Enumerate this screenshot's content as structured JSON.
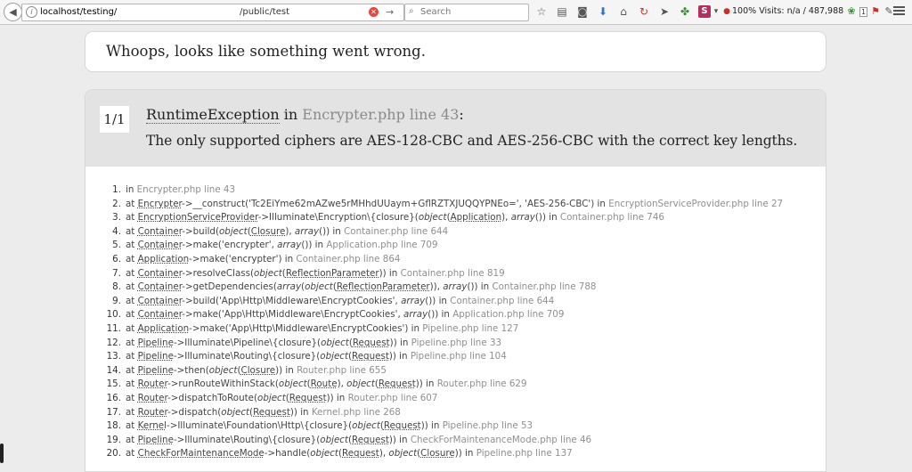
{
  "browser": {
    "url_host": "localhost/testing/",
    "url_path": "/public/test",
    "search_placeholder": "Search",
    "zoom": "100%",
    "visits": "Visits: n/a / 487,988",
    "tail_badge": "1"
  },
  "page": {
    "heading": "Whoops, looks like something went wrong.",
    "count": "1/1",
    "exception_class": "RuntimeException",
    "in_word": " in ",
    "exception_location": "Encrypter.php line 43",
    "colon": ":",
    "message": "The only supported ciphers are AES-128-CBC and AES-256-CBC with the correct key lengths."
  },
  "trace": [
    {
      "n": "1.",
      "parts": [
        [
          "t",
          "in "
        ],
        [
          "m",
          "Encrypter.php line 43"
        ]
      ]
    },
    {
      "n": "2.",
      "parts": [
        [
          "t",
          "at "
        ],
        [
          "u",
          "Encrypter"
        ],
        [
          "t",
          "->__construct('Tc2EiYme62mAZwe5rMHhdUUaym+GflRZTXJUQQYPNEo=', 'AES-256-CBC') in "
        ],
        [
          "m",
          "EncryptionServiceProvider.php line 27"
        ]
      ]
    },
    {
      "n": "3.",
      "parts": [
        [
          "t",
          "at "
        ],
        [
          "u",
          "EncryptionServiceProvider"
        ],
        [
          "t",
          "->Illuminate\\Encryption\\{closure}("
        ],
        [
          "i",
          "object"
        ],
        [
          "t",
          "("
        ],
        [
          "u",
          "Application"
        ],
        [
          "t",
          "), "
        ],
        [
          "i",
          "array"
        ],
        [
          "t",
          "()) in "
        ],
        [
          "m",
          "Container.php line 746"
        ]
      ]
    },
    {
      "n": "4.",
      "parts": [
        [
          "t",
          "at "
        ],
        [
          "u",
          "Container"
        ],
        [
          "t",
          "->build("
        ],
        [
          "i",
          "object"
        ],
        [
          "t",
          "("
        ],
        [
          "u",
          "Closure"
        ],
        [
          "t",
          "), "
        ],
        [
          "i",
          "array"
        ],
        [
          "t",
          "()) in "
        ],
        [
          "m",
          "Container.php line 644"
        ]
      ]
    },
    {
      "n": "5.",
      "parts": [
        [
          "t",
          "at "
        ],
        [
          "u",
          "Container"
        ],
        [
          "t",
          "->make('encrypter', "
        ],
        [
          "i",
          "array"
        ],
        [
          "t",
          "()) in "
        ],
        [
          "m",
          "Application.php line 709"
        ]
      ]
    },
    {
      "n": "6.",
      "parts": [
        [
          "t",
          "at "
        ],
        [
          "u",
          "Application"
        ],
        [
          "t",
          "->make('encrypter') in "
        ],
        [
          "m",
          "Container.php line 864"
        ]
      ]
    },
    {
      "n": "7.",
      "parts": [
        [
          "t",
          "at "
        ],
        [
          "u",
          "Container"
        ],
        [
          "t",
          "->resolveClass("
        ],
        [
          "i",
          "object"
        ],
        [
          "t",
          "("
        ],
        [
          "u",
          "ReflectionParameter"
        ],
        [
          "t",
          ")) in "
        ],
        [
          "m",
          "Container.php line 819"
        ]
      ]
    },
    {
      "n": "8.",
      "parts": [
        [
          "t",
          "at "
        ],
        [
          "u",
          "Container"
        ],
        [
          "t",
          "->getDependencies("
        ],
        [
          "i",
          "array"
        ],
        [
          "t",
          "("
        ],
        [
          "i",
          "object"
        ],
        [
          "t",
          "("
        ],
        [
          "u",
          "ReflectionParameter"
        ],
        [
          "t",
          ")), "
        ],
        [
          "i",
          "array"
        ],
        [
          "t",
          "()) in "
        ],
        [
          "m",
          "Container.php line 788"
        ]
      ]
    },
    {
      "n": "9.",
      "parts": [
        [
          "t",
          "at "
        ],
        [
          "u",
          "Container"
        ],
        [
          "t",
          "->build('App\\Http\\Middleware\\EncryptCookies', "
        ],
        [
          "i",
          "array"
        ],
        [
          "t",
          "()) in "
        ],
        [
          "m",
          "Container.php line 644"
        ]
      ]
    },
    {
      "n": "10.",
      "parts": [
        [
          "t",
          "at "
        ],
        [
          "u",
          "Container"
        ],
        [
          "t",
          "->make('App\\Http\\Middleware\\EncryptCookies', "
        ],
        [
          "i",
          "array"
        ],
        [
          "t",
          "()) in "
        ],
        [
          "m",
          "Application.php line 709"
        ]
      ]
    },
    {
      "n": "11.",
      "parts": [
        [
          "t",
          "at "
        ],
        [
          "u",
          "Application"
        ],
        [
          "t",
          "->make('App\\Http\\Middleware\\EncryptCookies') in "
        ],
        [
          "m",
          "Pipeline.php line 127"
        ]
      ]
    },
    {
      "n": "12.",
      "parts": [
        [
          "t",
          "at "
        ],
        [
          "u",
          "Pipeline"
        ],
        [
          "t",
          "->Illuminate\\Pipeline\\{closure}("
        ],
        [
          "i",
          "object"
        ],
        [
          "t",
          "("
        ],
        [
          "u",
          "Request"
        ],
        [
          "t",
          ")) in "
        ],
        [
          "m",
          "Pipeline.php line 33"
        ]
      ]
    },
    {
      "n": "13.",
      "parts": [
        [
          "t",
          "at "
        ],
        [
          "u",
          "Pipeline"
        ],
        [
          "t",
          "->Illuminate\\Routing\\{closure}("
        ],
        [
          "i",
          "object"
        ],
        [
          "t",
          "("
        ],
        [
          "u",
          "Request"
        ],
        [
          "t",
          ")) in "
        ],
        [
          "m",
          "Pipeline.php line 104"
        ]
      ]
    },
    {
      "n": "14.",
      "parts": [
        [
          "t",
          "at "
        ],
        [
          "u",
          "Pipeline"
        ],
        [
          "t",
          "->then("
        ],
        [
          "i",
          "object"
        ],
        [
          "t",
          "("
        ],
        [
          "u",
          "Closure"
        ],
        [
          "t",
          ")) in "
        ],
        [
          "m",
          "Router.php line 655"
        ]
      ]
    },
    {
      "n": "15.",
      "parts": [
        [
          "t",
          "at "
        ],
        [
          "u",
          "Router"
        ],
        [
          "t",
          "->runRouteWithinStack("
        ],
        [
          "i",
          "object"
        ],
        [
          "t",
          "("
        ],
        [
          "u",
          "Route"
        ],
        [
          "t",
          "), "
        ],
        [
          "i",
          "object"
        ],
        [
          "t",
          "("
        ],
        [
          "u",
          "Request"
        ],
        [
          "t",
          ")) in "
        ],
        [
          "m",
          "Router.php line 629"
        ]
      ]
    },
    {
      "n": "16.",
      "parts": [
        [
          "t",
          "at "
        ],
        [
          "u",
          "Router"
        ],
        [
          "t",
          "->dispatchToRoute("
        ],
        [
          "i",
          "object"
        ],
        [
          "t",
          "("
        ],
        [
          "u",
          "Request"
        ],
        [
          "t",
          ")) in "
        ],
        [
          "m",
          "Router.php line 607"
        ]
      ]
    },
    {
      "n": "17.",
      "parts": [
        [
          "t",
          "at "
        ],
        [
          "u",
          "Router"
        ],
        [
          "t",
          "->dispatch("
        ],
        [
          "i",
          "object"
        ],
        [
          "t",
          "("
        ],
        [
          "u",
          "Request"
        ],
        [
          "t",
          ")) in "
        ],
        [
          "m",
          "Kernel.php line 268"
        ]
      ]
    },
    {
      "n": "18.",
      "parts": [
        [
          "t",
          "at "
        ],
        [
          "u",
          "Kernel"
        ],
        [
          "t",
          "->Illuminate\\Foundation\\Http\\{closure}("
        ],
        [
          "i",
          "object"
        ],
        [
          "t",
          "("
        ],
        [
          "u",
          "Request"
        ],
        [
          "t",
          ")) in "
        ],
        [
          "m",
          "Pipeline.php line 53"
        ]
      ]
    },
    {
      "n": "19.",
      "parts": [
        [
          "t",
          "at "
        ],
        [
          "u",
          "Pipeline"
        ],
        [
          "t",
          "->Illuminate\\Routing\\{closure}("
        ],
        [
          "i",
          "object"
        ],
        [
          "t",
          "("
        ],
        [
          "u",
          "Request"
        ],
        [
          "t",
          ")) in "
        ],
        [
          "m",
          "CheckForMaintenanceMode.php line 46"
        ]
      ]
    },
    {
      "n": "20.",
      "parts": [
        [
          "t",
          "at "
        ],
        [
          "u",
          "CheckForMaintenanceMode"
        ],
        [
          "t",
          "->handle("
        ],
        [
          "i",
          "object"
        ],
        [
          "t",
          "("
        ],
        [
          "u",
          "Request"
        ],
        [
          "t",
          "), "
        ],
        [
          "i",
          "object"
        ],
        [
          "t",
          "("
        ],
        [
          "u",
          "Closure"
        ],
        [
          "t",
          ")) in "
        ],
        [
          "m",
          "Pipeline.php line 137"
        ]
      ]
    }
  ]
}
